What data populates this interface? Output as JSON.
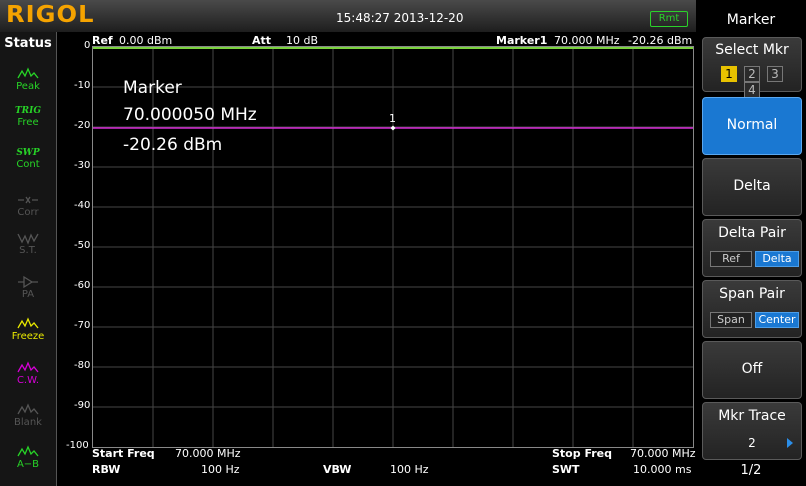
{
  "header": {
    "logo": "RIGOL",
    "datetime": "15:48:27 2013-12-20",
    "remote_badge": "Rmt"
  },
  "status_bar": {
    "title": "Status",
    "items": [
      {
        "label": "Peak",
        "icon": "peak-icon",
        "color": "#27d327"
      },
      {
        "label": "Free",
        "icon": "trig-text",
        "sub": "TRIG",
        "color": "#27d327"
      },
      {
        "label": "Cont",
        "icon": "swp-text",
        "sub": "SWP",
        "color": "#27d327"
      },
      {
        "label": "Corr",
        "icon": "corr-icon",
        "color": "#555555"
      },
      {
        "label": "S.T.",
        "icon": "st-icon",
        "color": "#555555"
      },
      {
        "label": "PA",
        "icon": "pa-icon",
        "color": "#555555"
      },
      {
        "label": "Freeze",
        "icon": "freeze-icon",
        "color": "#e8e800"
      },
      {
        "label": "C.W.",
        "icon": "cw-icon",
        "color": "#d600d6"
      },
      {
        "label": "Blank",
        "icon": "blank-icon",
        "color": "#555555"
      },
      {
        "label": "A−B",
        "icon": "amb-icon",
        "color": "#27d327"
      }
    ]
  },
  "display": {
    "ref_label": "Ref",
    "ref_value": "0.00 dBm",
    "att_label": "Att",
    "att_value": "10 dB",
    "marker_label": "Marker1",
    "marker_freq": "70.000 MHz",
    "marker_amp": "-20.26 dBm",
    "y_ticks": [
      "0",
      "-10",
      "-20",
      "-30",
      "-40",
      "-50",
      "-60",
      "-70",
      "-80",
      "-90",
      "-100"
    ],
    "marker_readout": {
      "title": "Marker",
      "freq": "70.000050 MHz",
      "amp": "-20.26 dBm"
    },
    "marker_number": "1",
    "trace_level_db": -20.26,
    "ref_level_db": 0,
    "scale_min_db": -100,
    "marker_position_fraction": 0.5,
    "colors": {
      "ref_line": "#7ad23e",
      "trace": "#d52bd5",
      "grid": "#464646"
    }
  },
  "footer": {
    "start_label": "Start Freq",
    "start_value": "70.000 MHz",
    "stop_label": "Stop Freq",
    "stop_value": "70.000 MHz",
    "rbw_label": "RBW",
    "rbw_value": "100 Hz",
    "vbw_label": "VBW",
    "vbw_value": "100 Hz",
    "swt_label": "SWT",
    "swt_value": "10.000 ms"
  },
  "menu": {
    "title": "Marker",
    "select_mkr": {
      "label": "Select Mkr",
      "options": [
        "1",
        "2",
        "3",
        "4"
      ],
      "selected": "1"
    },
    "normal": "Normal",
    "delta": "Delta",
    "delta_pair": {
      "label": "Delta Pair",
      "ref": "Ref",
      "delta": "Delta"
    },
    "span_pair": {
      "label": "Span Pair",
      "span": "Span",
      "center": "Center"
    },
    "off": "Off",
    "mkr_trace": {
      "label": "Mkr Trace",
      "value": "2"
    },
    "page": "1/2",
    "accent_color": "#1a78d2"
  }
}
